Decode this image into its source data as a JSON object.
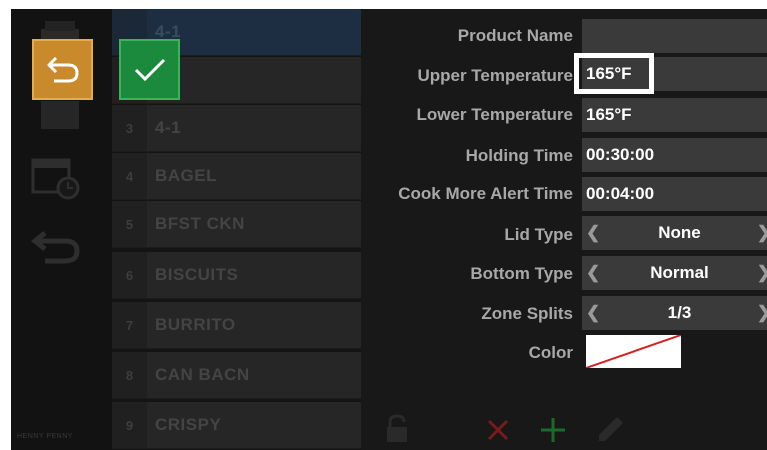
{
  "brand": {
    "text": "HENNY PENNY"
  },
  "list": {
    "rows": [
      {
        "num": "",
        "name": "4-1"
      },
      {
        "num": "",
        "name": ""
      },
      {
        "num": "3",
        "name": "4-1"
      },
      {
        "num": "4",
        "name": "BAGEL"
      },
      {
        "num": "5",
        "name": "BFST CKN"
      },
      {
        "num": "6",
        "name": "BISCUITS"
      },
      {
        "num": "7",
        "name": "BURRITO"
      },
      {
        "num": "8",
        "name": "CAN BACN"
      },
      {
        "num": "9",
        "name": "CRISPY"
      }
    ]
  },
  "fields": {
    "product_name": {
      "label": "Product Name",
      "value": ""
    },
    "upper_temp": {
      "label": "Upper Temperature",
      "value": "165°F"
    },
    "lower_temp": {
      "label": "Lower Temperature",
      "value": "165°F"
    },
    "holding_time": {
      "label": "Holding Time",
      "value": "00:30:00"
    },
    "cook_more": {
      "label": "Cook More Alert Time",
      "value": "00:04:00"
    },
    "lid_type": {
      "label": "Lid Type",
      "value": "None"
    },
    "bottom_type": {
      "label": "Bottom Type",
      "value": "Normal"
    },
    "zone_splits": {
      "label": "Zone Splits",
      "value": "1/3"
    },
    "color": {
      "label": "Color"
    }
  },
  "selector_arrows": {
    "left": "❮",
    "right": "❯"
  },
  "colors": {
    "back_button": "#c88a2a",
    "confirm_button": "#1c8a3c",
    "delete_icon": "#7a1a1a",
    "add_icon": "#1a6a2a"
  }
}
